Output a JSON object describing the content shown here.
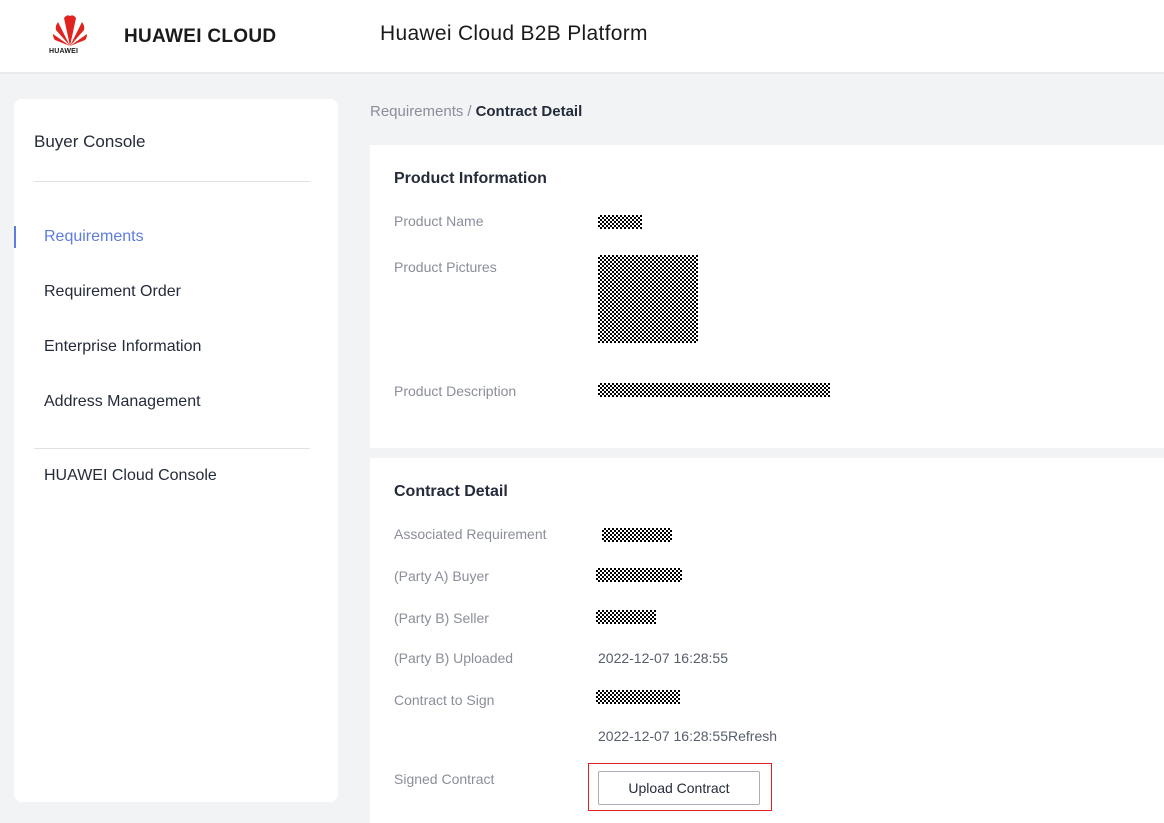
{
  "header": {
    "logo_word": "HUAWEI",
    "brand": "HUAWEI CLOUD",
    "app_title": "Huawei Cloud B2B Platform"
  },
  "sidebar": {
    "title": "Buyer Console",
    "items": [
      {
        "label": "Requirements",
        "active": true
      },
      {
        "label": "Requirement Order",
        "active": false
      },
      {
        "label": "Enterprise Information",
        "active": false
      },
      {
        "label": "Address Management",
        "active": false
      }
    ],
    "console_link": "HUAWEI Cloud Console"
  },
  "breadcrumb": {
    "parent": "Requirements",
    "separator": "/",
    "current": "Contract Detail"
  },
  "product_info": {
    "title": "Product Information",
    "name_label": "Product Name",
    "pictures_label": "Product Pictures",
    "description_label": "Product Description"
  },
  "contract": {
    "title": "Contract Detail",
    "associated_label": "Associated Requirement",
    "buyer_label": "(Party A) Buyer",
    "seller_label": "(Party B) Seller",
    "uploaded_label": "(Party B) Uploaded",
    "uploaded_value": "2022-12-07 16:28:55",
    "to_sign_label": "Contract to Sign",
    "to_sign_time": "2022-12-07 16:28:55",
    "refresh_label": "Refresh",
    "signed_label": "Signed Contract",
    "upload_button": "Upload Contract"
  },
  "colors": {
    "accent": "#5e7ce0",
    "highlight": "#e02020",
    "background": "#f2f3f5"
  }
}
